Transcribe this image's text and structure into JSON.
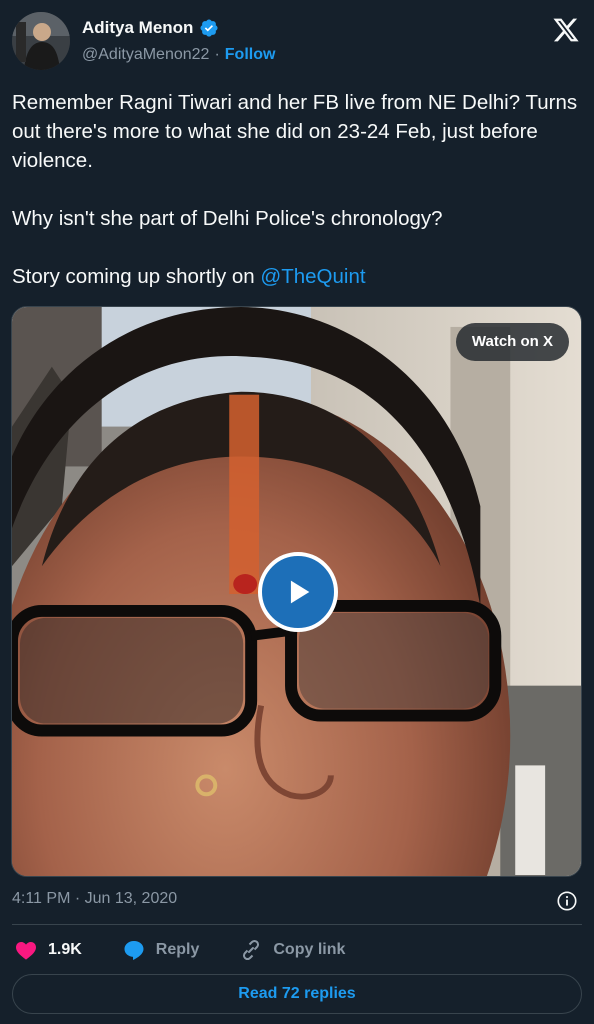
{
  "author": {
    "name": "Aditya Menon",
    "handle": "@AdityaMenon22",
    "separator": "·",
    "follow_label": "Follow"
  },
  "tweet": {
    "line1": "Remember Ragni Tiwari and her FB live from NE Delhi? Turns out there's more to what she did on 23-24 Feb, just before violence.",
    "line2": "Why isn't she part of Delhi Police's chronology?",
    "line3_prefix": "Story coming up shortly on ",
    "mention": "@TheQuint"
  },
  "media": {
    "watch_label": "Watch on X"
  },
  "meta": {
    "timestamp": "4:11 PM · Jun 13, 2020"
  },
  "actions": {
    "like_count": "1.9K",
    "reply_label": "Reply",
    "copy_label": "Copy link"
  },
  "replies_button": "Read 72 replies",
  "colors": {
    "background": "#15202b",
    "accent": "#1d9bf0",
    "like": "#f91880",
    "muted": "#8b98a5"
  }
}
